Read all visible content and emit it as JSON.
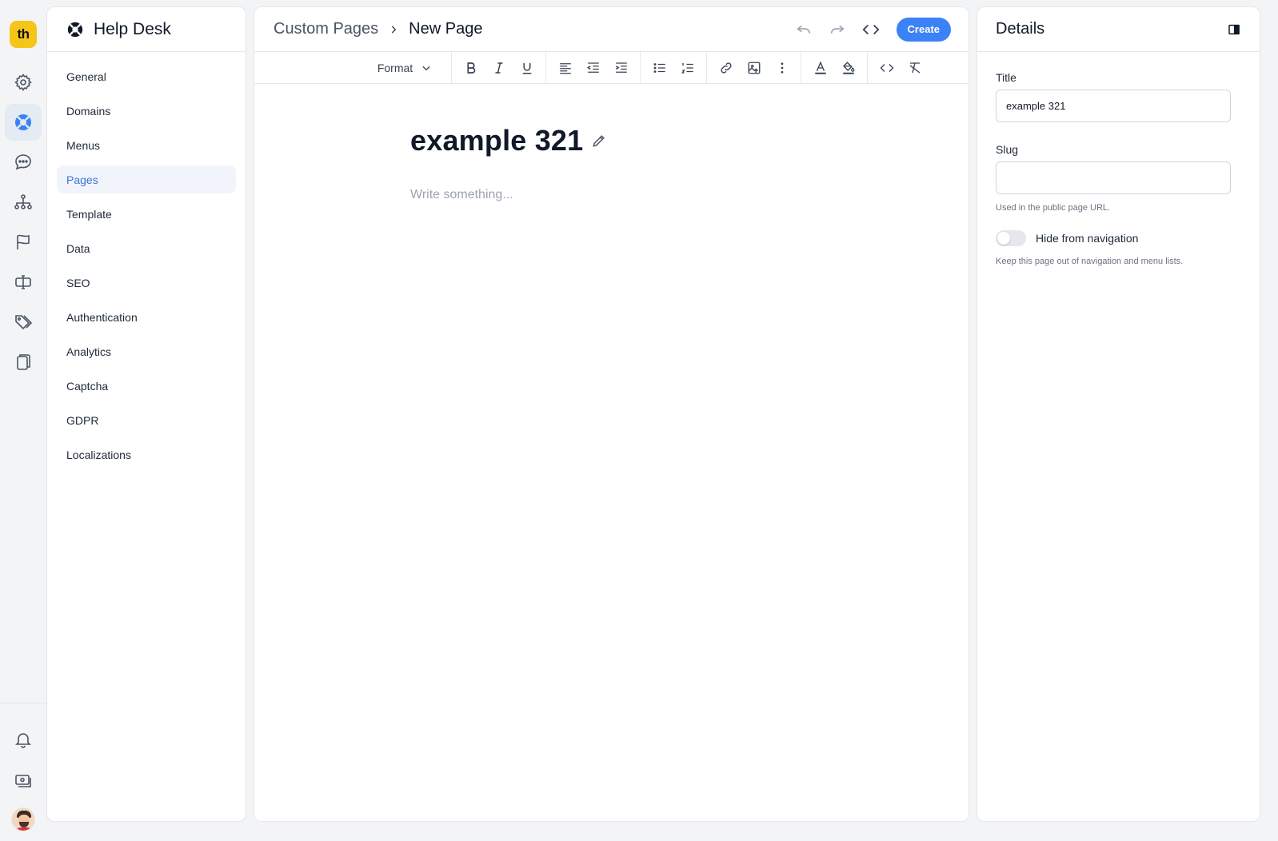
{
  "app": {
    "logo_text": "th",
    "accent_color": "#3b82f6",
    "brand_color": "#f5c518"
  },
  "rail": {
    "top_icons": [
      "settings-icon",
      "help-desk-lifebuoy-icon",
      "chat-icon",
      "sitemap-icon",
      "flag-icon",
      "text-cursor-icon",
      "tags-icon",
      "copy-pages-icon"
    ],
    "active_icon": "help-desk-lifebuoy-icon",
    "bottom_icons": [
      "bell-icon",
      "billing-icon",
      "user-avatar"
    ]
  },
  "nav": {
    "title": "Help Desk",
    "items": [
      {
        "label": "General"
      },
      {
        "label": "Domains"
      },
      {
        "label": "Menus"
      },
      {
        "label": "Pages",
        "active": true
      },
      {
        "label": "Template"
      },
      {
        "label": "Data"
      },
      {
        "label": "SEO"
      },
      {
        "label": "Authentication"
      },
      {
        "label": "Analytics"
      },
      {
        "label": "Captcha"
      },
      {
        "label": "GDPR"
      },
      {
        "label": "Localizations"
      }
    ]
  },
  "editor": {
    "breadcrumb": {
      "parent": "Custom Pages",
      "current": "New Page"
    },
    "create_label": "Create",
    "toolbar": {
      "format_label": "Format",
      "buttons": [
        "bold",
        "italic",
        "underline",
        "align-left",
        "outdent",
        "indent",
        "bullet-list",
        "numbered-list",
        "link",
        "image",
        "more",
        "text-color",
        "highlight",
        "code",
        "clear-format"
      ]
    },
    "page_title": "example 321",
    "body_placeholder": "Write something..."
  },
  "details": {
    "title": "Details",
    "title_field": {
      "label": "Title",
      "value": "example 321"
    },
    "slug_field": {
      "label": "Slug",
      "value": "",
      "hint": "Used in the public page URL."
    },
    "hide_toggle": {
      "label": "Hide from navigation",
      "checked": false,
      "hint": "Keep this page out of navigation and menu lists."
    }
  }
}
